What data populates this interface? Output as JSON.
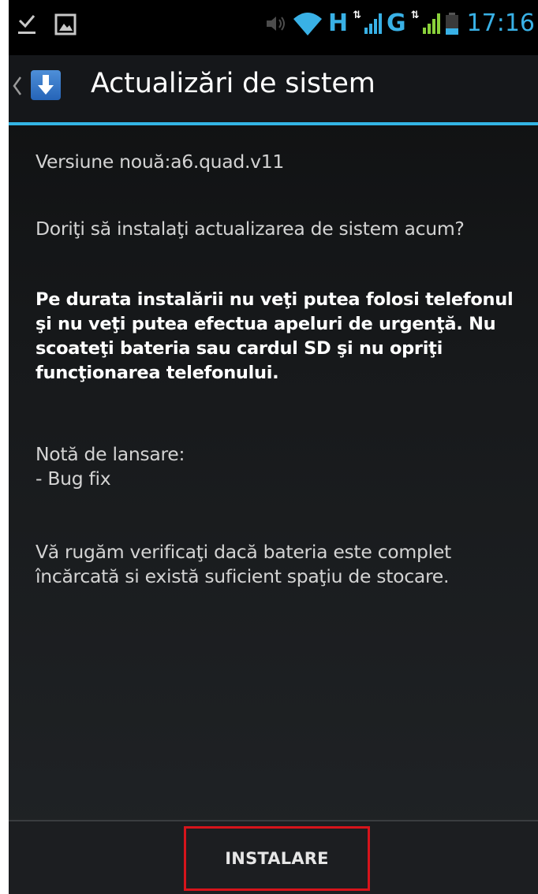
{
  "status_bar": {
    "clock": "17:16",
    "network_1": "H",
    "network_2": "G",
    "icons": [
      "download-done-icon",
      "image-icon",
      "volume-icon",
      "wifi-icon",
      "signal-icon",
      "signal-icon",
      "battery-icon"
    ],
    "accent_color": "#39b1e6"
  },
  "action_bar": {
    "title": "Actualizări de sistem",
    "accent_line_color": "#33b5e5"
  },
  "content": {
    "version": "Versiune nouă:a6.quad.v11",
    "question": "Doriţi să instalaţi actualizarea de sistem acum?",
    "warning": "Pe durata instalării nu veţi putea folosi telefonul şi nu veţi putea efectua apeluri de urgenţă. Nu scoateţi bateria sau cardul SD şi nu opriţi funcţionarea telefonului.",
    "release_notes_label": "Notă de lansare:",
    "release_notes_item": "- Bug fix",
    "battery_check": "Vă rugăm verificaţi dacă bateria este complet încărcată si există suficient spaţiu de stocare."
  },
  "buttons": {
    "install_label": "INSTALARE",
    "highlight_color": "#d6141b"
  }
}
